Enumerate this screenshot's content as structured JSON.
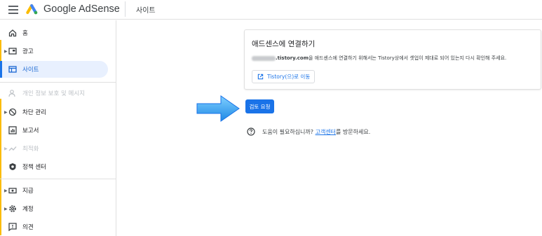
{
  "header": {
    "brand": "Google AdSense",
    "breadcrumb": "사이트"
  },
  "sidebar": {
    "items": [
      {
        "label": "홈",
        "icon": "home-icon"
      },
      {
        "label": "광고",
        "icon": "ads-icon"
      },
      {
        "label": "사이트",
        "icon": "sites-icon"
      },
      {
        "label": "개인 정보 보호 및 메시지",
        "icon": "privacy-icon"
      },
      {
        "label": "차단 관리",
        "icon": "block-icon"
      },
      {
        "label": "보고서",
        "icon": "reports-icon"
      },
      {
        "label": "최적화",
        "icon": "optimize-icon"
      },
      {
        "label": "정책 센터",
        "icon": "policy-icon"
      },
      {
        "label": "지급",
        "icon": "payments-icon"
      },
      {
        "label": "계정",
        "icon": "gear-icon"
      },
      {
        "label": "의견",
        "icon": "feedback-icon"
      }
    ]
  },
  "card": {
    "title": "애드센스에 연결하기",
    "domain_suffix": ".tistory.com",
    "description": "을 애드센스에 연결하기 위해서는 Tistory상에서 셋업이 제대로 되어 있는지 다시 확인해 주세요.",
    "link_label": "Tistory(으)로 이동"
  },
  "review_button": "검토 요청",
  "help": {
    "prefix": "도움이 필요하십니까? ",
    "link": "고객센터",
    "suffix": "를 방문하세요."
  },
  "colors": {
    "accent": "#1a73e8",
    "active_bg": "#e8f0fe",
    "arrow": "#3aa0e8"
  }
}
